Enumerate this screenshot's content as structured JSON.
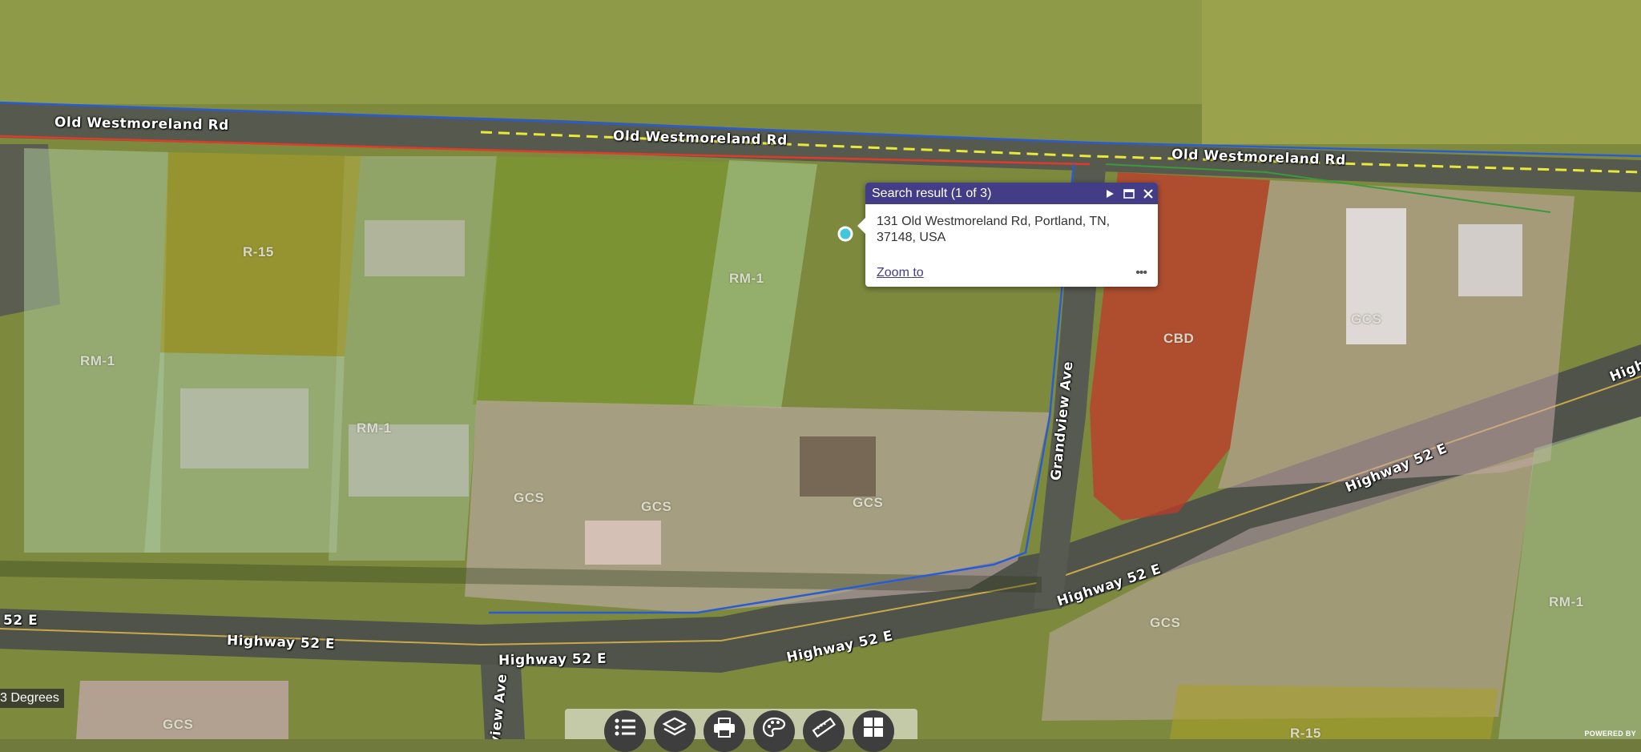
{
  "map": {
    "roads": {
      "old_westmoreland": "Old Westmoreland Rd",
      "highway_52e": "Highway 52 E",
      "highway_prefix": "High",
      "grandview": "Grandview Ave",
      "view_ave_fragment": "view Ave",
      "hwy_left_fragment": "52 E"
    },
    "zones": {
      "r15": "R-15",
      "rm1": "RM-1",
      "gcs": "GCS",
      "cbd": "CBD"
    },
    "bearing_text": "3 Degrees",
    "powered_by": "POWERED BY",
    "colors": {
      "popup_header": "#433d87",
      "cbd_fill": "#c0392b",
      "blue_line": "#2a5bd7",
      "red_line": "#e03a2a",
      "yellow_dash": "#e8e83a"
    }
  },
  "popup": {
    "title": "Search result (1 of 3)",
    "address_line1": "131 Old Westmoreland Rd, Portland, TN,",
    "address_line2": "37148, USA",
    "zoom_to": "Zoom to",
    "more": "•••"
  },
  "toolbar": {
    "tools": [
      "legend-icon",
      "layers-icon",
      "print-icon",
      "basemap-icon",
      "measure-icon",
      "grid-icon"
    ]
  }
}
